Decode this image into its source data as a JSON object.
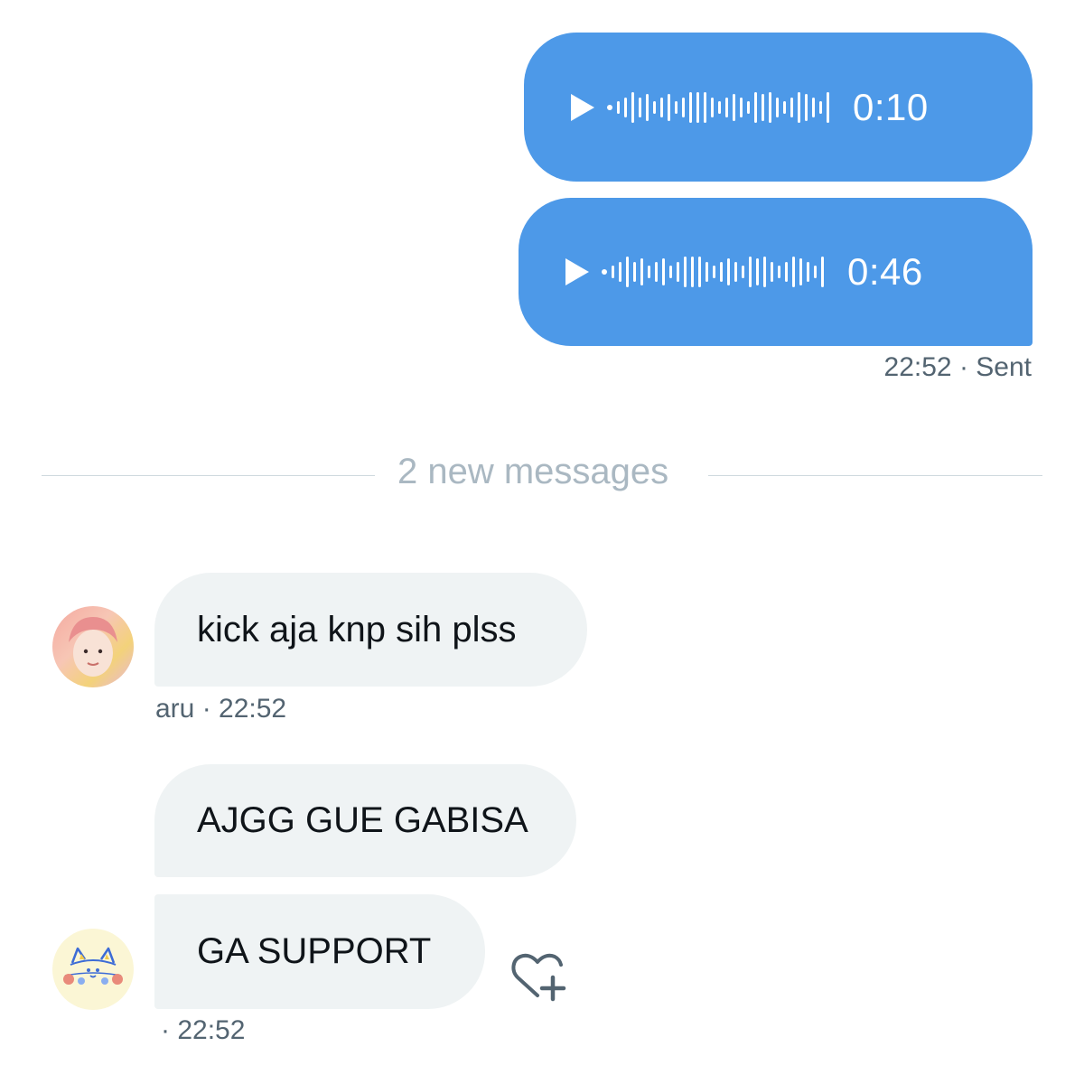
{
  "outgoing": {
    "voice_messages": [
      {
        "duration": "0:10"
      },
      {
        "duration": "0:46"
      }
    ],
    "meta_time": "22:52",
    "meta_status": "· Sent",
    "bubble_color": "#4d99e8"
  },
  "divider": {
    "label": "2 new messages"
  },
  "incoming": {
    "messages": [
      {
        "text": "kick aja knp sih plss"
      },
      {
        "text": "AJGG GUE GABISA"
      },
      {
        "text": "GA SUPPORT"
      }
    ],
    "meta_1": "aru · 22:52",
    "meta_2": "· 22:52",
    "bubble_color": "#eff3f4"
  },
  "icons": {
    "play": "play-icon",
    "react": "add-reaction-icon"
  }
}
